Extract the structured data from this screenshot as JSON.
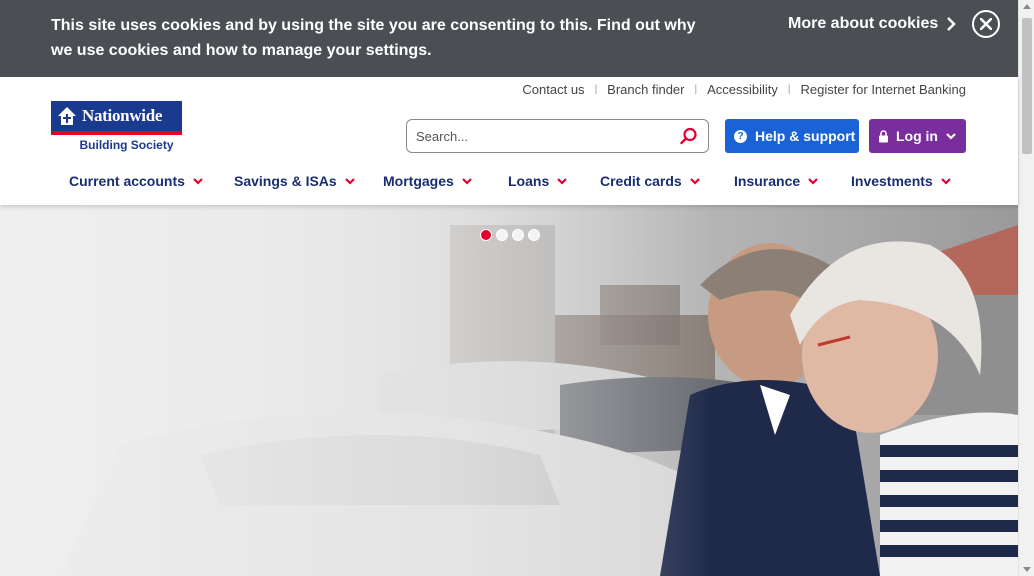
{
  "cookie": {
    "message": "This site uses cookies and by using the site you are consenting to this. Find out why we use cookies and how to manage your settings.",
    "more_label": "More about cookies"
  },
  "utility_links": [
    "Contact us",
    "Branch finder",
    "Accessibility",
    "Register for Internet Banking"
  ],
  "logo": {
    "name": "Nationwide",
    "subtitle": "Building Society"
  },
  "search": {
    "placeholder": "Search..."
  },
  "buttons": {
    "help": "Help & support",
    "login": "Log in"
  },
  "nav": [
    "Current accounts",
    "Savings & ISAs",
    "Mortgages",
    "Loans",
    "Credit cards",
    "Insurance",
    "Investments"
  ],
  "carousel": {
    "slides": 4,
    "active": 1
  },
  "colors": {
    "cookie_bg": "#4b4f54",
    "brand_blue": "#1a3a8f",
    "brand_red": "#e4002b",
    "help_blue": "#1a63d6",
    "login_purple": "#7a2e9e",
    "nav_text": "#1a2e6e"
  }
}
